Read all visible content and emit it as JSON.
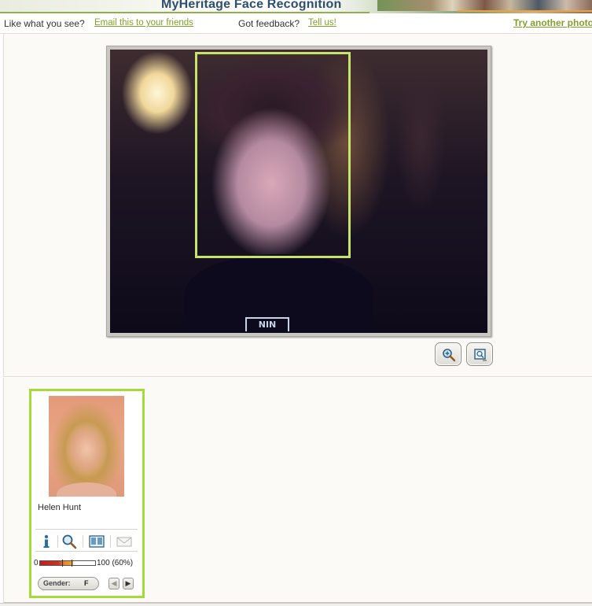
{
  "header": {
    "title": "MyHeritage Face Recognition"
  },
  "topbar": {
    "like_text": "Like what you see?",
    "email_link": "Email this to your friends",
    "feedback_text": "Got feedback?",
    "tellus_link": "Tell us!",
    "try_link": "Try another photo"
  },
  "photo": {
    "shirt_logo": "NIN"
  },
  "tools": [
    {
      "name": "zoom-in",
      "icon": "magnifier-plus-icon"
    },
    {
      "name": "fit-to-frame",
      "icon": "frame-icon"
    }
  ],
  "result": {
    "name": "Helen Hunt",
    "score_min": "0",
    "score_label": "100 (60%)",
    "score_fraction": 0.6,
    "gender_label": "Gender:",
    "gender_value": "F",
    "icons": [
      "info-icon",
      "search-icon",
      "compare-faces-icon",
      "envelope-icon"
    ],
    "colors": {
      "card_border": "#a6d93a",
      "link_green": "#7fa12b",
      "face_box": "#c8e36a"
    }
  }
}
